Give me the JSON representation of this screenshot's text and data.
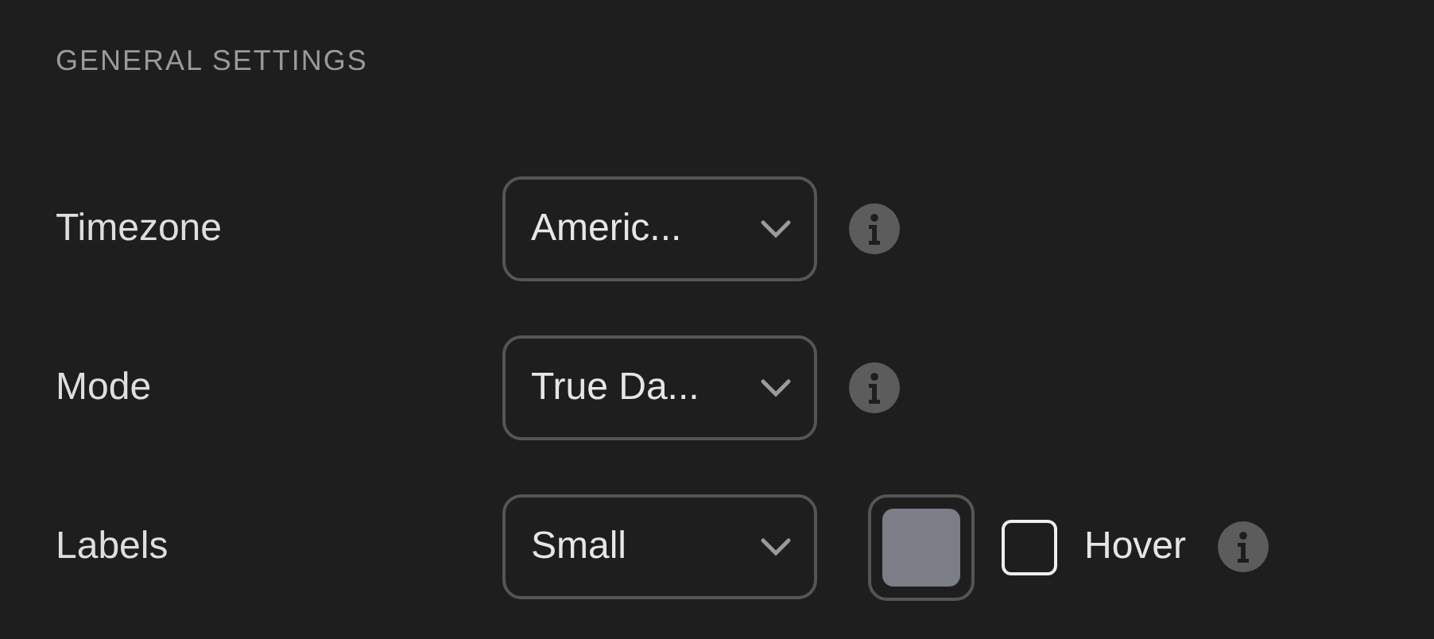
{
  "section_title": "GENERAL SETTINGS",
  "rows": [
    {
      "kind": "select",
      "label": "Timezone",
      "value": "Americ..."
    },
    {
      "kind": "select",
      "label": "Mode",
      "value": "True Da..."
    },
    {
      "kind": "select_color_toggle",
      "label": "Labels",
      "value": "Small",
      "color": "#7b7d87",
      "toggle": {
        "label": "Hover",
        "checked": false
      }
    }
  ]
}
